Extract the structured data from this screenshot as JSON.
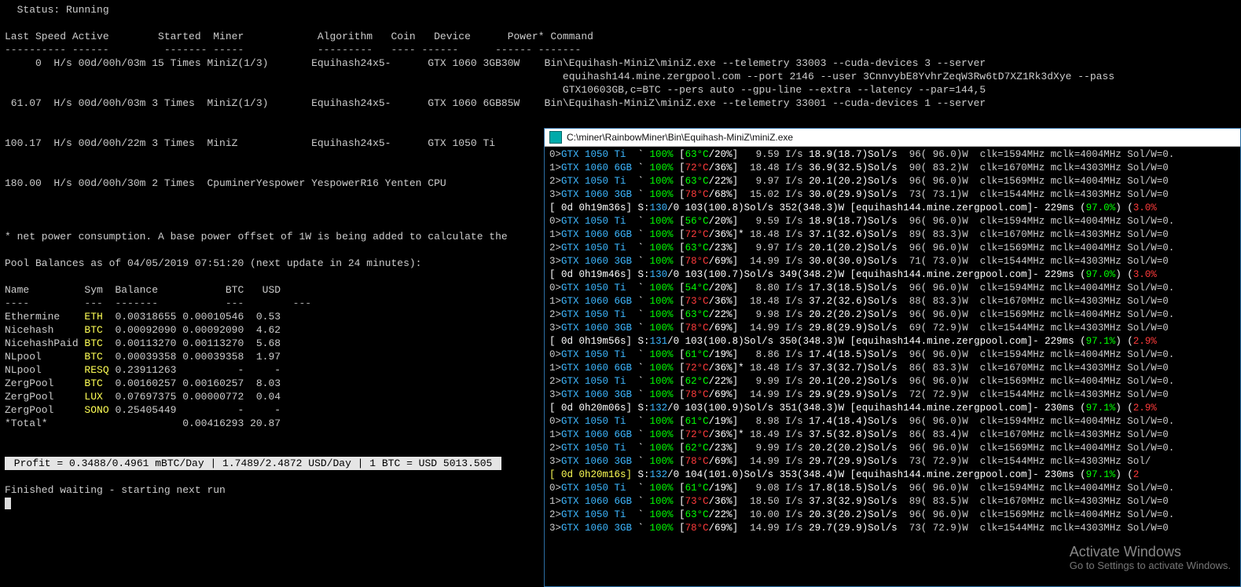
{
  "status_line": "  Status: Running",
  "headers": [
    "Last Speed",
    "Active",
    "Started",
    "Miner",
    "Algorithm",
    "Coin",
    "Device",
    "Power*",
    "Command"
  ],
  "header_rule": "---------- ------         ------- -----            ---------   ---- ------      ------ -------",
  "miners": [
    {
      "speed": "     0  H/s",
      "active": "00d/00h/03m",
      "started": "15 Times",
      "miner": "MiniZ(1/3)",
      "algo": "Equihash24x5",
      "coin": "-",
      "device": "GTX 1060 3GB",
      "power": "30W",
      "cmd": "Bin\\Equihash-MiniZ\\miniZ.exe --telemetry 33003 --cuda-devices 3 --server"
    },
    {
      "cont": "equihash144.mine.zergpool.com --port 2146 --user 3CnnvybE8YvhrZeqW3Rw6tD7XZ1Rk3dXye --pass"
    },
    {
      "cont": "GTX10603GB,c=BTC --pers auto --gpu-line --extra --latency --par=144,5"
    },
    {
      "speed": " 61.07  H/s",
      "active": "00d/00h/03m",
      "started": "3 Times",
      "miner": "MiniZ(1/3)",
      "algo": "Equihash24x5",
      "coin": "-",
      "device": "GTX 1060 6GB",
      "power": "85W",
      "cmd": "Bin\\Equihash-MiniZ\\miniZ.exe --telemetry 33001 --cuda-devices 1 --server"
    },
    {
      "blank": true
    },
    {
      "blank": true
    },
    {
      "speed": "100.17  H/s",
      "active": "00d/00h/22m",
      "started": "3 Times",
      "miner": "MiniZ",
      "algo": "Equihash24x5",
      "coin": "-",
      "device": "GTX 1050 Ti",
      "power": "",
      "cmd": ""
    },
    {
      "blank": true
    },
    {
      "blank": true
    },
    {
      "speed": "180.00  H/s",
      "active": "00d/00h/30m",
      "started": "2 Times",
      "miner": "CpuminerYespower",
      "algo": "YespowerR16",
      "coin": "Yenten",
      "device": "CPU",
      "power": "",
      "cmd": ""
    }
  ],
  "footnote": "* net power consumption. A base power offset of 1W is being added to calculate the",
  "pool_balances_label": "Pool Balances as of 04/05/2019 07:51:20 (next update in 24 minutes):",
  "bal_headers": [
    "Name",
    "Sym",
    "Balance",
    "BTC",
    "USD"
  ],
  "bal_rule": "----         ---  -------           ---        ---",
  "balances": [
    {
      "name": "Ethermine",
      "sym": "ETH",
      "bal": "0.00318655",
      "btc": "0.00010546",
      "usd": "0.53"
    },
    {
      "name": "Nicehash",
      "sym": "BTC",
      "bal": "0.00092090",
      "btc": "0.00092090",
      "usd": "4.62"
    },
    {
      "name": "NicehashPaid",
      "sym": "BTC",
      "bal": "0.00113270",
      "btc": "0.00113270",
      "usd": "5.68"
    },
    {
      "name": "NLpool",
      "sym": "BTC",
      "bal": "0.00039358",
      "btc": "0.00039358",
      "usd": "1.97"
    },
    {
      "name": "NLpool",
      "sym": "RESQ",
      "bal": "0.23911263",
      "btc": "-",
      "usd": "-"
    },
    {
      "name": "ZergPool",
      "sym": "BTC",
      "bal": "0.00160257",
      "btc": "0.00160257",
      "usd": "8.03"
    },
    {
      "name": "ZergPool",
      "sym": "LUX",
      "bal": "0.07697375",
      "btc": "0.00000772",
      "usd": "0.04"
    },
    {
      "name": "ZergPool",
      "sym": "SONO",
      "bal": "0.25405449",
      "btc": "-",
      "usd": "-"
    },
    {
      "name": "*Total*",
      "sym": "",
      "bal": "",
      "btc": "0.00416293",
      "usd": "20.87"
    }
  ],
  "profit_line": " Profit = 0.3488/0.4961 mBTC/Day | 1.7489/2.4872 USD/Day | 1 BTC = USD 5013.505 ",
  "finished_line": "Finished waiting - starting next run",
  "sub_title": "C:\\miner\\RainbowMiner\\Bin\\Equihash-MiniZ\\miniZ.exe",
  "gpu_lines": [
    {
      "idx": "0>",
      "gpu": "GTX 1050 Ti",
      "fan": "100%",
      "temp": "63°C",
      "tc": "g",
      "load": "/20%",
      "is": " 9.59 I/s",
      "sol": "18.9(18.7)Sol/s",
      "pw": "96( 96.0)W",
      "clk": "clk=1594MHz mclk=4004MHz Sol/W=0."
    },
    {
      "idx": "1>",
      "gpu": "GTX 1060 6GB",
      "fan": "100%",
      "temp": "72°C",
      "tc": "r",
      "load": "/36%",
      "is": "18.48 I/s",
      "sol": "36.9(32.5)Sol/s",
      "pw": "90( 83.2)W",
      "clk": "clk=1670MHz mclk=4303MHz Sol/W=0"
    },
    {
      "idx": "2>",
      "gpu": "GTX 1050 Ti",
      "fan": "100%",
      "temp": "63°C",
      "tc": "g",
      "load": "/22%",
      "is": " 9.97 I/s",
      "sol": "20.1(20.2)Sol/s",
      "pw": "96( 96.0)W",
      "clk": "clk=1569MHz mclk=4004MHz Sol/W=0"
    },
    {
      "idx": "3>",
      "gpu": "GTX 1060 3GB",
      "fan": "100%",
      "temp": "78°C",
      "tc": "r",
      "load": "/68%",
      "is": "15.02 I/s",
      "sol": "30.0(29.9)Sol/s",
      "pw": "73( 73.1)W",
      "clk": "clk=1544MHz mclk=4303MHz Sol/W=0"
    },
    {
      "sum": true,
      "time": "0d 0h19m36s",
      "s": "130",
      "rest": "/0 103(100.8)Sol/s 352(348.3)W [equihash144.mine.zergpool.com]- 229ms",
      "pct": "97.0%",
      "tail": "3.0%"
    },
    {
      "idx": "0>",
      "gpu": "GTX 1050 Ti",
      "fan": "100%",
      "temp": "56°C",
      "tc": "g",
      "load": "/20%",
      "is": " 9.59 I/s",
      "sol": "18.9(18.7)Sol/s",
      "pw": "96( 96.0)W",
      "clk": "clk=1594MHz mclk=4004MHz Sol/W=0."
    },
    {
      "idx": "1>",
      "gpu": "GTX 1060 6GB",
      "fan": "100%",
      "temp": "72°C",
      "tc": "r",
      "load": "/36%",
      "star": "*",
      "is": "18.48 I/s",
      "sol": "37.1(32.6)Sol/s",
      "pw": "89( 83.3)W",
      "clk": "clk=1670MHz mclk=4303MHz Sol/W=0"
    },
    {
      "idx": "2>",
      "gpu": "GTX 1050 Ti",
      "fan": "100%",
      "temp": "63°C",
      "tc": "g",
      "load": "/23%",
      "is": " 9.97 I/s",
      "sol": "20.1(20.2)Sol/s",
      "pw": "96( 96.0)W",
      "clk": "clk=1569MHz mclk=4004MHz Sol/W=0."
    },
    {
      "idx": "3>",
      "gpu": "GTX 1060 3GB",
      "fan": "100%",
      "temp": "78°C",
      "tc": "r",
      "load": "/69%",
      "is": "14.99 I/s",
      "sol": "30.0(30.0)Sol/s",
      "pw": "71( 73.0)W",
      "clk": "clk=1544MHz mclk=4303MHz Sol/W=0"
    },
    {
      "sum": true,
      "time": "0d 0h19m46s",
      "s": "130",
      "rest": "/0 103(100.7)Sol/s 349(348.2)W [equihash144.mine.zergpool.com]- 229ms",
      "pct": "97.0%",
      "tail": "3.0%"
    },
    {
      "idx": "0>",
      "gpu": "GTX 1050 Ti",
      "fan": "100%",
      "temp": "54°C",
      "tc": "g",
      "load": "/20%",
      "is": " 8.80 I/s",
      "sol": "17.3(18.5)Sol/s",
      "pw": "96( 96.0)W",
      "clk": "clk=1594MHz mclk=4004MHz Sol/W=0."
    },
    {
      "idx": "1>",
      "gpu": "GTX 1060 6GB",
      "fan": "100%",
      "temp": "73°C",
      "tc": "r",
      "load": "/36%",
      "is": "18.48 I/s",
      "sol": "37.2(32.6)Sol/s",
      "pw": "88( 83.3)W",
      "clk": "clk=1670MHz mclk=4303MHz Sol/W=0"
    },
    {
      "idx": "2>",
      "gpu": "GTX 1050 Ti",
      "fan": "100%",
      "temp": "63°C",
      "tc": "g",
      "load": "/22%",
      "is": " 9.98 I/s",
      "sol": "20.2(20.2)Sol/s",
      "pw": "96( 96.0)W",
      "clk": "clk=1569MHz mclk=4004MHz Sol/W=0."
    },
    {
      "idx": "3>",
      "gpu": "GTX 1060 3GB",
      "fan": "100%",
      "temp": "78°C",
      "tc": "r",
      "load": "/69%",
      "is": "14.99 I/s",
      "sol": "29.8(29.9)Sol/s",
      "pw": "69( 72.9)W",
      "clk": "clk=1544MHz mclk=4303MHz Sol/W=0"
    },
    {
      "sum": true,
      "time": "0d 0h19m56s",
      "s": "131",
      "rest": "/0 103(100.8)Sol/s 350(348.3)W [equihash144.mine.zergpool.com]- 229ms",
      "pct": "97.1%",
      "tail": "2.9%"
    },
    {
      "idx": "0>",
      "gpu": "GTX 1050 Ti",
      "fan": "100%",
      "temp": "61°C",
      "tc": "g",
      "load": "/19%",
      "is": " 8.86 I/s",
      "sol": "17.4(18.5)Sol/s",
      "pw": "96( 96.0)W",
      "clk": "clk=1594MHz mclk=4004MHz Sol/W=0."
    },
    {
      "idx": "1>",
      "gpu": "GTX 1060 6GB",
      "fan": "100%",
      "temp": "72°C",
      "tc": "r",
      "load": "/36%",
      "star": "*",
      "is": "18.48 I/s",
      "sol": "37.3(32.7)Sol/s",
      "pw": "86( 83.3)W",
      "clk": "clk=1670MHz mclk=4303MHz Sol/W=0"
    },
    {
      "idx": "2>",
      "gpu": "GTX 1050 Ti",
      "fan": "100%",
      "temp": "62°C",
      "tc": "g",
      "load": "/22%",
      "is": " 9.99 I/s",
      "sol": "20.1(20.2)Sol/s",
      "pw": "96( 96.0)W",
      "clk": "clk=1569MHz mclk=4004MHz Sol/W=0."
    },
    {
      "idx": "3>",
      "gpu": "GTX 1060 3GB",
      "fan": "100%",
      "temp": "78°C",
      "tc": "r",
      "load": "/69%",
      "is": "14.99 I/s",
      "sol": "29.9(29.9)Sol/s",
      "pw": "72( 72.9)W",
      "clk": "clk=1544MHz mclk=4303MHz Sol/W=0"
    },
    {
      "sum": true,
      "time": "0d 0h20m06s",
      "s": "132",
      "rest": "/0 103(100.9)Sol/s 351(348.3)W [equihash144.mine.zergpool.com]- 230ms",
      "pct": "97.1%",
      "tail": "2.9%"
    },
    {
      "idx": "0>",
      "gpu": "GTX 1050 Ti",
      "fan": "100%",
      "temp": "61°C",
      "tc": "g",
      "load": "/19%",
      "is": " 8.98 I/s",
      "sol": "17.4(18.4)Sol/s",
      "pw": "96( 96.0)W",
      "clk": "clk=1594MHz mclk=4004MHz Sol/W=0."
    },
    {
      "idx": "1>",
      "gpu": "GTX 1060 6GB",
      "fan": "100%",
      "temp": "72°C",
      "tc": "r",
      "load": "/36%",
      "star": "*",
      "is": "18.49 I/s",
      "sol": "37.5(32.8)Sol/s",
      "pw": "86( 83.4)W",
      "clk": "clk=1670MHz mclk=4303MHz Sol/W=0"
    },
    {
      "idx": "2>",
      "gpu": "GTX 1050 Ti",
      "fan": "100%",
      "temp": "62°C",
      "tc": "g",
      "load": "/23%",
      "is": " 9.99 I/s",
      "sol": "20.2(20.2)Sol/s",
      "pw": "96( 96.0)W",
      "clk": "clk=1569MHz mclk=4004MHz Sol/W=0."
    },
    {
      "idx": "3>",
      "gpu": "GTX 1060 3GB",
      "fan": "100%",
      "temp": "78°C",
      "tc": "r",
      "load": "/69%",
      "is": "14.99 I/s",
      "sol": "29.7(29.9)Sol/s",
      "pw": "73( 72.9)W",
      "clk": "clk=1544MHz mclk=4303MHz Sol/"
    },
    {
      "sum": true,
      "yel": true,
      "time": "0d 0h20m16s",
      "s": "132",
      "rest": "/0 104(101.0)Sol/s 353(348.4)W [equihash144.mine.zergpool.com]- 230ms",
      "pct": "97.1%",
      "tail": "2"
    },
    {
      "idx": "0>",
      "gpu": "GTX 1050 Ti",
      "fan": "100%",
      "temp": "61°C",
      "tc": "g",
      "load": "/19%",
      "is": " 9.08 I/s",
      "sol": "17.8(18.5)Sol/s",
      "pw": "96( 96.0)W",
      "clk": "clk=1594MHz mclk=4004MHz Sol/W=0."
    },
    {
      "idx": "1>",
      "gpu": "GTX 1060 6GB",
      "fan": "100%",
      "temp": "73°C",
      "tc": "r",
      "load": "/36%",
      "is": "18.50 I/s",
      "sol": "37.3(32.9)Sol/s",
      "pw": "89( 83.5)W",
      "clk": "clk=1670MHz mclk=4303MHz Sol/W=0"
    },
    {
      "idx": "2>",
      "gpu": "GTX 1050 Ti",
      "fan": "100%",
      "temp": "63°C",
      "tc": "g",
      "load": "/22%",
      "is": "10.00 I/s",
      "sol": "20.3(20.2)Sol/s",
      "pw": "96( 96.0)W",
      "clk": "clk=1569MHz mclk=4004MHz Sol/W=0."
    },
    {
      "idx": "3>",
      "gpu": "GTX 1060 3GB",
      "fan": "100%",
      "temp": "78°C",
      "tc": "r",
      "load": "/69%",
      "is": "14.99 I/s",
      "sol": "29.7(29.9)Sol/s",
      "pw": "73( 72.9)W",
      "clk": "clk=1544MHz mclk=4303MHz Sol/W=0"
    }
  ],
  "watermark": {
    "l1": "Activate Windows",
    "l2": "Go to Settings to activate Windows."
  }
}
